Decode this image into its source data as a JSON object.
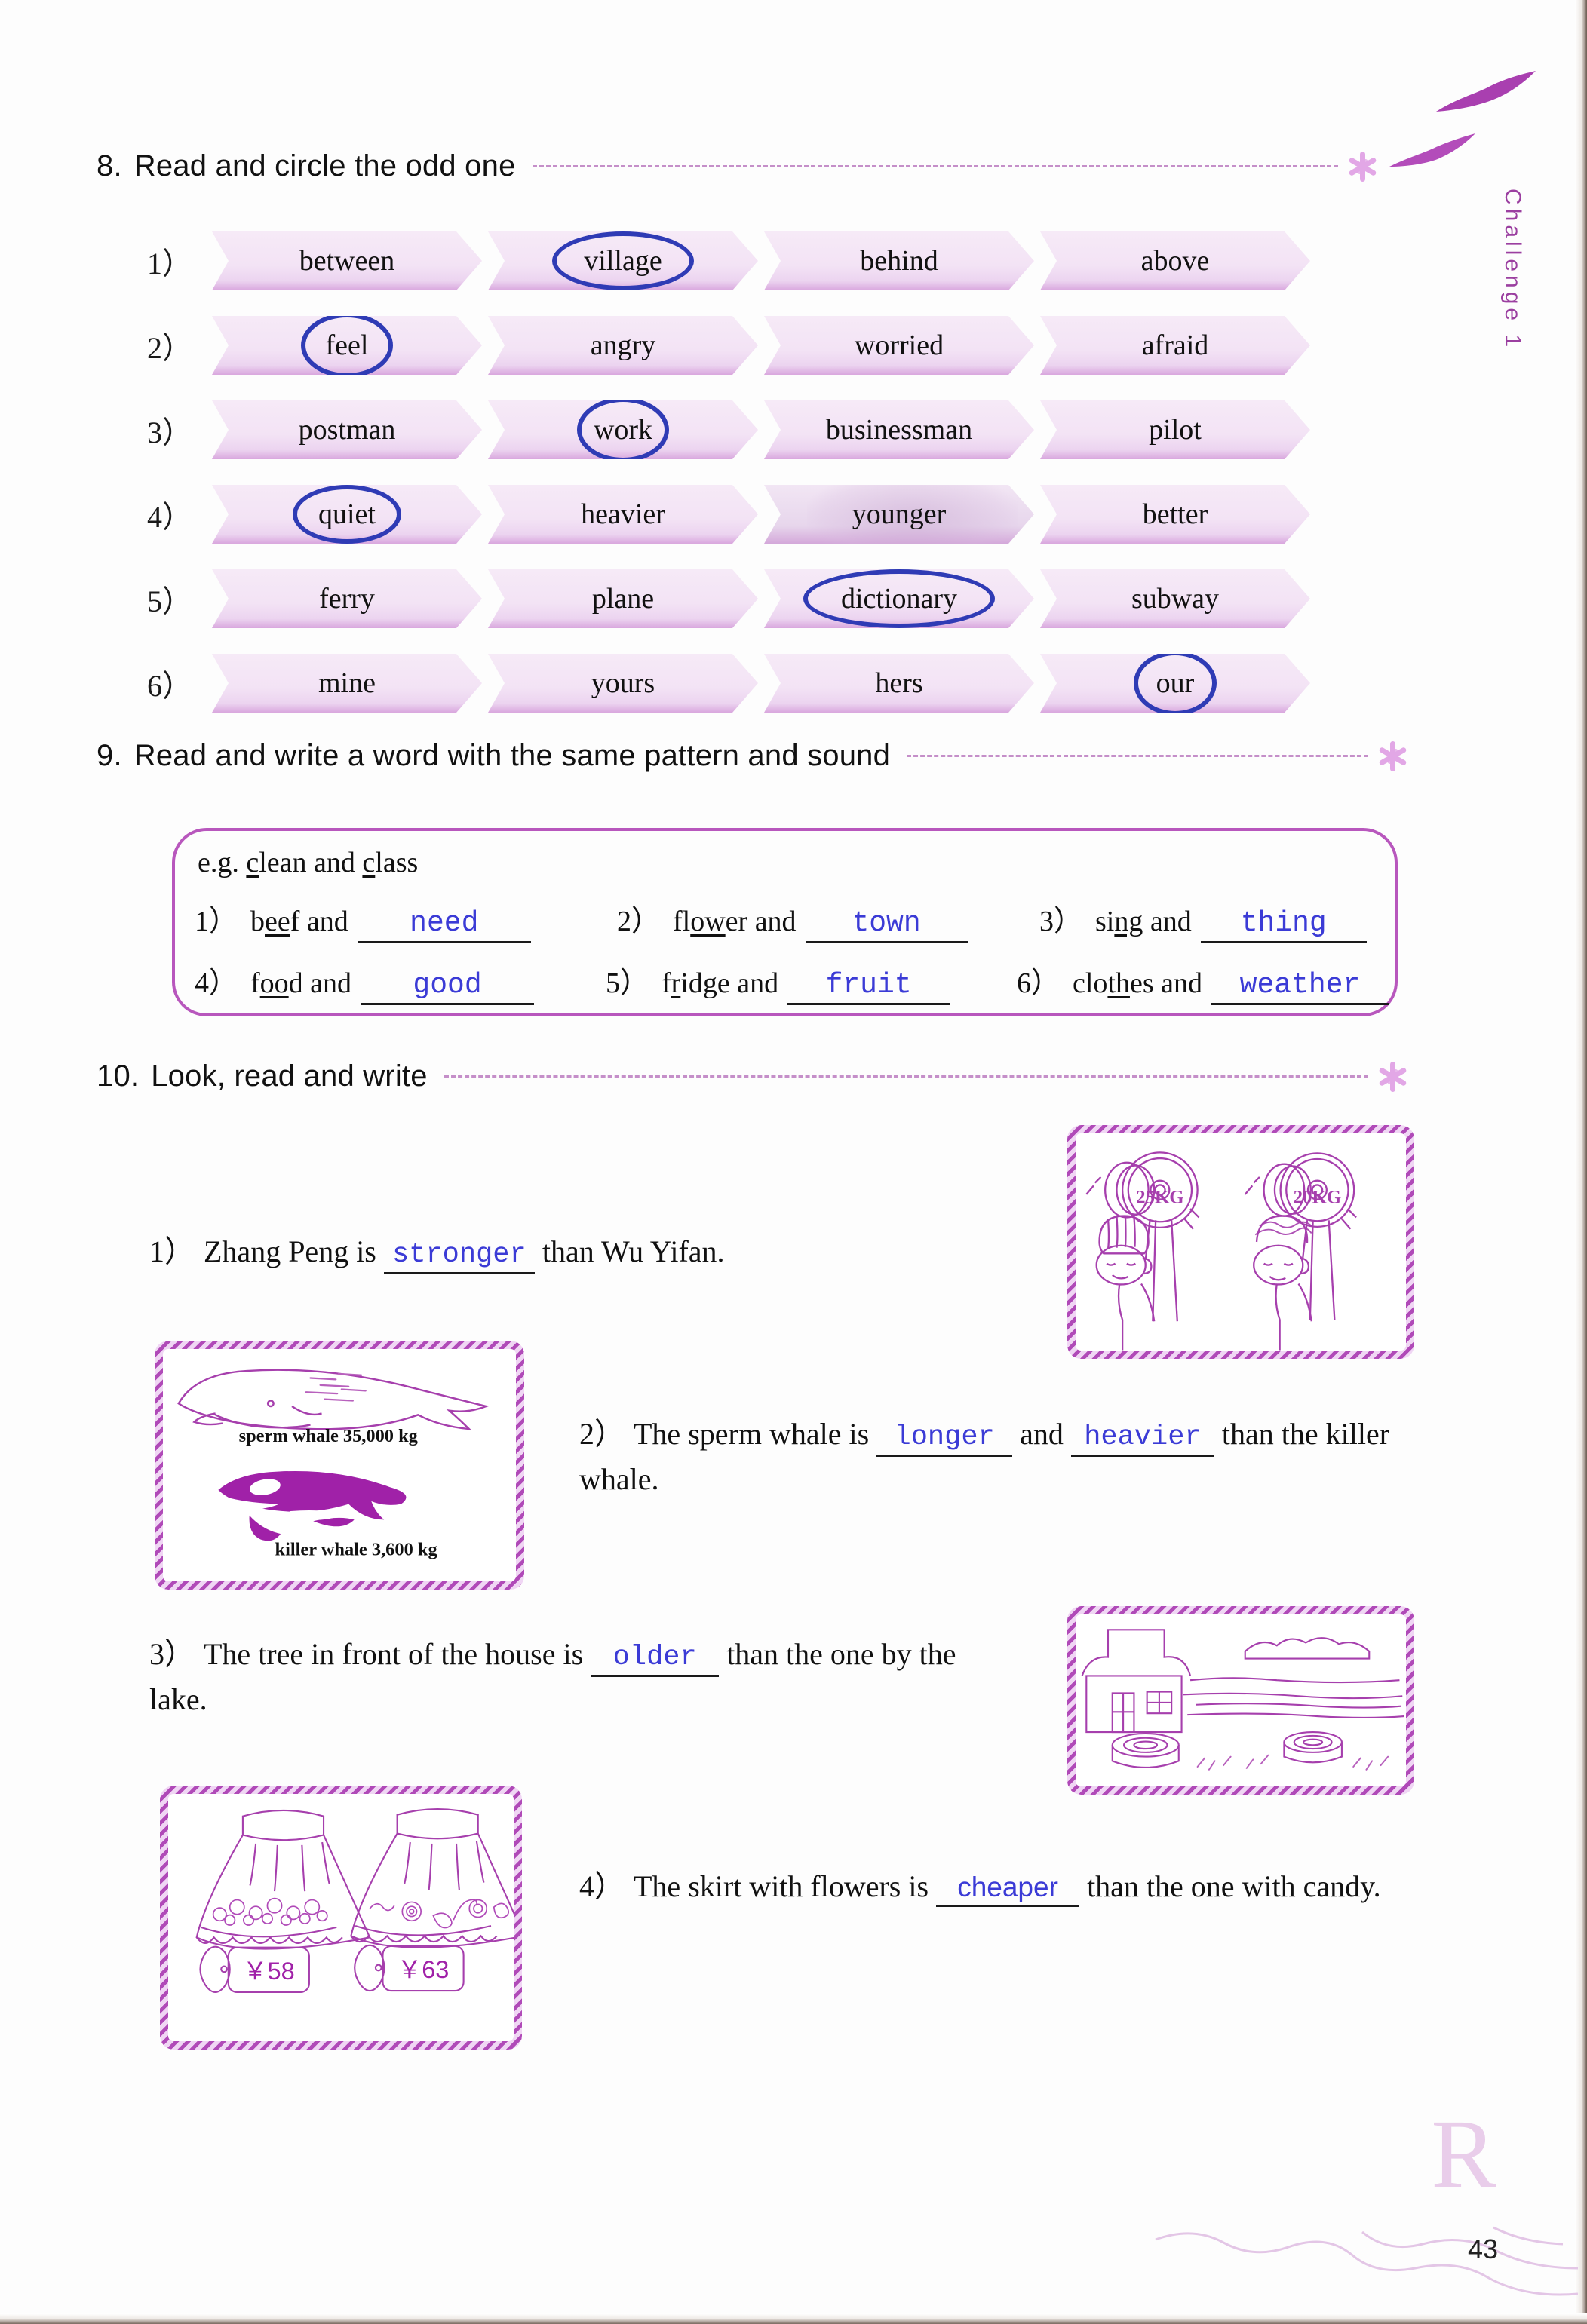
{
  "page": {
    "number": "43",
    "challenge_label": "Challenge 1"
  },
  "exercise8": {
    "number": "8.",
    "title": "Read and circle the odd one",
    "rows": [
      {
        "no": "1）",
        "words": [
          "between",
          "village",
          "behind",
          "above"
        ],
        "circled": 1
      },
      {
        "no": "2）",
        "words": [
          "feel",
          "angry",
          "worried",
          "afraid"
        ],
        "circled": 0
      },
      {
        "no": "3）",
        "words": [
          "postman",
          "work",
          "businessman",
          "pilot"
        ],
        "circled": 1
      },
      {
        "no": "4）",
        "words": [
          "quiet",
          "heavier",
          "younger",
          "better"
        ],
        "circled": 0
      },
      {
        "no": "5）",
        "words": [
          "ferry",
          "plane",
          "dictionary",
          "subway"
        ],
        "circled": 2
      },
      {
        "no": "6）",
        "words": [
          "mine",
          "yours",
          "hers",
          "our"
        ],
        "circled": 3
      }
    ]
  },
  "exercise9": {
    "number": "9.",
    "title": "Read and write a word with the same pattern and sound",
    "example_prefix": "e.g. ",
    "example_word1": "clean",
    "example_and": " and ",
    "example_word2": "class",
    "items": [
      {
        "no": "1）",
        "prompt_pre": "b",
        "prompt_underlined": "ee",
        "prompt_post": "f and",
        "answer": "need"
      },
      {
        "no": "2）",
        "prompt_pre": "fl",
        "prompt_underlined": "ow",
        "prompt_post": "er and",
        "answer": "town"
      },
      {
        "no": "3）",
        "prompt_pre": "si",
        "prompt_underlined": "ng",
        "prompt_post": " and",
        "answer": "thing"
      },
      {
        "no": "4）",
        "prompt_pre": "f",
        "prompt_underlined": "oo",
        "prompt_post": "d and",
        "answer": "good"
      },
      {
        "no": "5）",
        "prompt_pre": "f",
        "prompt_underlined": "r",
        "prompt_post": "idge and",
        "answer": "fruit"
      },
      {
        "no": "6）",
        "prompt_pre": "clo",
        "prompt_underlined": "th",
        "prompt_post": "es and",
        "answer": "weather"
      }
    ]
  },
  "exercise10": {
    "number": "10.",
    "title": "Look, read and write",
    "sentences": [
      {
        "no": "1）",
        "before": "Zhang Peng is ",
        "answer": "stronger",
        "after": " than Wu Yifan."
      },
      {
        "no": "2）",
        "before": "The sperm whale is ",
        "answer": "longer",
        "middle": " and ",
        "answer2": "heavier",
        "after": " than the killer whale."
      },
      {
        "no": "3）",
        "before": "The tree in front of the house is ",
        "answer": "older",
        "after": " than the one by the lake."
      },
      {
        "no": "4）",
        "before": "The skirt with flowers is ",
        "answer": "cheaper",
        "after": " than the one with candy."
      }
    ],
    "illustrations": {
      "weights": {
        "left_label": "25KG",
        "right_label": "20KG"
      },
      "whales": {
        "caption1": "sperm whale 35,000 kg",
        "caption2": "killer whale 3,600 kg"
      },
      "skirts": {
        "price1": "￥58",
        "price2": "￥63"
      }
    }
  },
  "colors": {
    "banner_pink": "#f3e3f5",
    "banner_edge": "#d9a7de",
    "circle_blue": "#2f3bb5",
    "handwriting_blue": "#3b3bd6",
    "purple_ink": "#b04ab8",
    "magenta": "#9b3fa0"
  }
}
